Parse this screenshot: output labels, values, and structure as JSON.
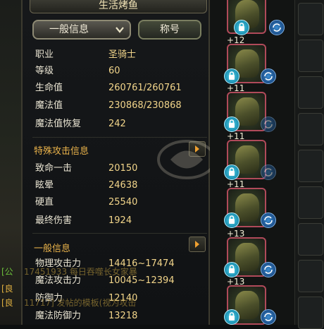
{
  "panel": {
    "title": "生活烤鱼",
    "dropdown_label": "一般信息",
    "title_tab_label": "称号"
  },
  "basic_stats": [
    {
      "label": "职业",
      "value": "圣骑士"
    },
    {
      "label": "等级",
      "value": "60"
    },
    {
      "label": "生命值",
      "value": "260761/260761"
    },
    {
      "label": "魔法值",
      "value": "230868/230868"
    },
    {
      "label": "魔法值恢复",
      "value": "242"
    }
  ],
  "special_attack": {
    "header": "特殊攻击信息",
    "rows": [
      {
        "label": "致命一击",
        "value": "20150"
      },
      {
        "label": "眩晕",
        "value": "24638"
      },
      {
        "label": "硬直",
        "value": "25540"
      },
      {
        "label": "最终伤害",
        "value": "1924"
      }
    ]
  },
  "general_info": {
    "header": "一般信息",
    "rows": [
      {
        "label": "物理攻击力",
        "value": "14416~17474"
      },
      {
        "label": "魔法攻击力",
        "value": "10045~12394"
      },
      {
        "label": "防御力",
        "value": "12140"
      },
      {
        "label": "魔法防御力",
        "value": "13218"
      }
    ]
  },
  "equipment": {
    "slots": [
      {
        "enhance": ""
      },
      {
        "enhance": "+12"
      },
      {
        "enhance": "+11"
      },
      {
        "enhance": "+11"
      },
      {
        "enhance": "+11"
      },
      {
        "enhance": "+13"
      },
      {
        "enhance": "+13"
      }
    ]
  },
  "colors": {
    "value_gold": "#f2d58a",
    "header_orange": "#e9b24a",
    "slot_border": "#b04a5a",
    "lock_cyan": "#4fd0e8"
  },
  "chat": {
    "line1": "[公",
    "line2": "[良",
    "line3": "[良",
    "overlay1": "17451933 每日吞噬长女家暴",
    "overlay2": "11717] 发帖的模板(视为攻击"
  }
}
